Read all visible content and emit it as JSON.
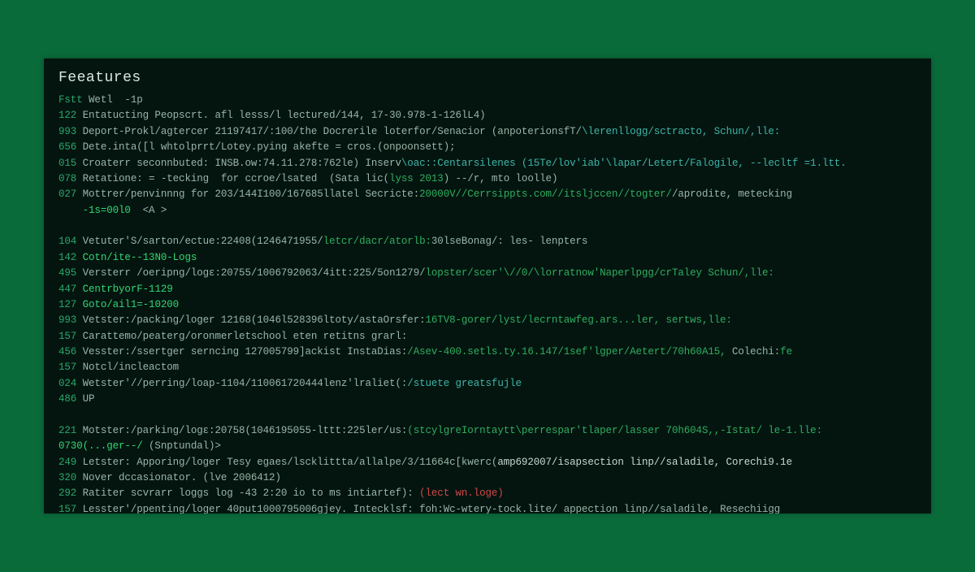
{
  "title": "Feeatures",
  "lines": [
    {
      "id": "l0",
      "segs": [
        {
          "c": "num",
          "t": "Fstt"
        },
        {
          "c": "txt",
          "t": " Wetl  -1p"
        }
      ]
    },
    {
      "id": "l1",
      "segs": [
        {
          "c": "num",
          "t": "122"
        },
        {
          "c": "txt",
          "t": " Entatucting Peopscrt. afl lesss/l lectured/144, 17-30.978-1-126lL4)"
        }
      ]
    },
    {
      "id": "l2",
      "segs": [
        {
          "c": "num",
          "t": "993"
        },
        {
          "c": "txt",
          "t": " Deport-Prokl/agtercer 21197417/:100/the Docrerile loterfor/Senacior (anpoterionsfT/"
        },
        {
          "c": "cyan",
          "t": "\\lerenllogg/sctracto, Schun/,lle:"
        }
      ]
    },
    {
      "id": "l3",
      "segs": [
        {
          "c": "num",
          "t": "656"
        },
        {
          "c": "txt",
          "t": " Dete.inta([l whtolprrt/Lotey.pying akefte = cros.(onpoonsett);"
        }
      ]
    },
    {
      "id": "l4",
      "segs": [
        {
          "c": "num",
          "t": "015"
        },
        {
          "c": "txt",
          "t": " Croaterr seconnbuted: INSB.ow:74.11.278:762le) Inserv"
        },
        {
          "c": "cyan",
          "t": "\\oac::Centarsilenes (15Te/lov'iab'\\lapar/Letert/Falogile, --lecltf =1.ltt."
        }
      ]
    },
    {
      "id": "l5",
      "segs": [
        {
          "c": "num",
          "t": "078"
        },
        {
          "c": "txt",
          "t": " Retatione: = -tecking  for ccroe/lsated  (Sata lic("
        },
        {
          "c": "green",
          "t": "lyss 2013"
        },
        {
          "c": "txt",
          "t": ") --/r, mto loolle)"
        }
      ]
    },
    {
      "id": "l6",
      "segs": [
        {
          "c": "num",
          "t": "027"
        },
        {
          "c": "txt",
          "t": " Mottrer/penvinnng for 203/144I100/167685llatel Secricte:"
        },
        {
          "c": "green",
          "t": "20000V//Cerrsippts.com//itsljccen//togter/"
        },
        {
          "c": "txt",
          "t": "/aprodite, metecking"
        }
      ]
    },
    {
      "id": "l7",
      "segs": [
        {
          "c": "txt",
          "t": "    "
        },
        {
          "c": "bgreen",
          "t": "-1s=00l0"
        },
        {
          "c": "txt",
          "t": "  <A >"
        }
      ]
    },
    {
      "id": "blank1",
      "segs": [
        {
          "c": "txt",
          "t": " "
        }
      ]
    },
    {
      "id": "l8",
      "segs": [
        {
          "c": "num",
          "t": "104"
        },
        {
          "c": "txt",
          "t": " Vetuter'S/sarton/ectue:22408(1246471955/"
        },
        {
          "c": "green",
          "t": "letcr/dacr/atorlb:"
        },
        {
          "c": "txt",
          "t": "30lseBonag/: les- lenpters"
        }
      ]
    },
    {
      "id": "l9",
      "segs": [
        {
          "c": "num",
          "t": "142"
        },
        {
          "c": "txt",
          "t": " "
        },
        {
          "c": "bgreen",
          "t": "Cotn/ite--13N0-Logs"
        }
      ]
    },
    {
      "id": "l10",
      "segs": [
        {
          "c": "num",
          "t": "495"
        },
        {
          "c": "txt",
          "t": " Versterr /oeripng/logε:20755/1006792063/4itt:225/5on1279/"
        },
        {
          "c": "green",
          "t": "lopster/scer'\\//0/\\lorratnow'Naperlpgg/crTaley Schun/,lle:"
        }
      ]
    },
    {
      "id": "l11",
      "segs": [
        {
          "c": "num",
          "t": "447"
        },
        {
          "c": "txt",
          "t": " "
        },
        {
          "c": "bgreen",
          "t": "CentrbyorF-1129"
        }
      ]
    },
    {
      "id": "l12",
      "segs": [
        {
          "c": "num",
          "t": "127"
        },
        {
          "c": "txt",
          "t": " "
        },
        {
          "c": "bgreen",
          "t": "Goto/ail1=-10200"
        }
      ]
    },
    {
      "id": "l13",
      "segs": [
        {
          "c": "num",
          "t": "993"
        },
        {
          "c": "txt",
          "t": " Vetster:/packing/loger 12168(1046l528396ltoty/astaOrsfer:"
        },
        {
          "c": "green",
          "t": "16TV8-gorer/lyst/lecrntawfeg.ars...ler, sertws,lle:"
        }
      ]
    },
    {
      "id": "l14",
      "segs": [
        {
          "c": "num",
          "t": "157"
        },
        {
          "c": "txt",
          "t": " Carattemo/peaterg/oronmerletschool eten retitns grarl:"
        }
      ]
    },
    {
      "id": "l15",
      "segs": [
        {
          "c": "num",
          "t": "456"
        },
        {
          "c": "txt",
          "t": " Vesster:/ssertger serncing 127005799]ackist InstaDias:"
        },
        {
          "c": "green",
          "t": "/Asev-400.setls.ty.16.147/1sef'lgper/Aetert/70h60A15,"
        },
        {
          "c": "txt",
          "t": " Colechi:"
        },
        {
          "c": "green",
          "t": "fe"
        }
      ]
    },
    {
      "id": "l16",
      "segs": [
        {
          "c": "num",
          "t": "157"
        },
        {
          "c": "txt",
          "t": " Notcl/incleactom"
        }
      ]
    },
    {
      "id": "l17",
      "segs": [
        {
          "c": "num",
          "t": "024"
        },
        {
          "c": "txt",
          "t": " Wetster'//perring/loap-1104/110061720444lenz'lraliet(:"
        },
        {
          "c": "cyan",
          "t": "/stuete greatsfujle"
        }
      ]
    },
    {
      "id": "l18",
      "segs": [
        {
          "c": "num",
          "t": "486"
        },
        {
          "c": "txt",
          "t": " UP"
        }
      ]
    },
    {
      "id": "blank2",
      "segs": [
        {
          "c": "txt",
          "t": " "
        }
      ]
    },
    {
      "id": "l19",
      "segs": [
        {
          "c": "num",
          "t": "221"
        },
        {
          "c": "txt",
          "t": " Motster:/parking/logε:20758(1046195055-lttt:225ler/us:"
        },
        {
          "c": "green",
          "t": "(stcylgreIorntaytt\\perrespar'tlaper/lasser 70h604S,,-Istat/ le-1.lle:"
        }
      ]
    },
    {
      "id": "l20",
      "segs": [
        {
          "c": "bgreen",
          "t": "0730(...ger--/"
        },
        {
          "c": "txt",
          "t": " (Snptundal)>"
        }
      ]
    },
    {
      "id": "l21",
      "segs": [
        {
          "c": "num",
          "t": "249"
        },
        {
          "c": "txt",
          "t": " Letster: Apporing/loger Tesy egaes/lscklittta/allalpe/3/11664c[kwerc("
        },
        {
          "c": "white",
          "t": "amp692007/isapsection linp//saladile, Corechi9.1e"
        }
      ]
    },
    {
      "id": "l22",
      "segs": [
        {
          "c": "num",
          "t": "320"
        },
        {
          "c": "txt",
          "t": " Nover dccasionator. (lve 2006412)"
        }
      ]
    },
    {
      "id": "l23",
      "segs": [
        {
          "c": "num",
          "t": "292"
        },
        {
          "c": "txt",
          "t": " Ratiter scvrarr loggs log -43 2:20 io to ms intiartef): "
        },
        {
          "c": "red",
          "t": "(lect wn.loge)"
        }
      ]
    },
    {
      "id": "l24",
      "segs": [
        {
          "c": "num",
          "t": "157"
        },
        {
          "c": "txt",
          "t": " Lesster'/ppenting/loger 40put1000795006gjey. Intecklsf: foh:Wc-wtery-tock.lite/ appection linp//saladile, Resechiigg"
        }
      ]
    }
  ]
}
